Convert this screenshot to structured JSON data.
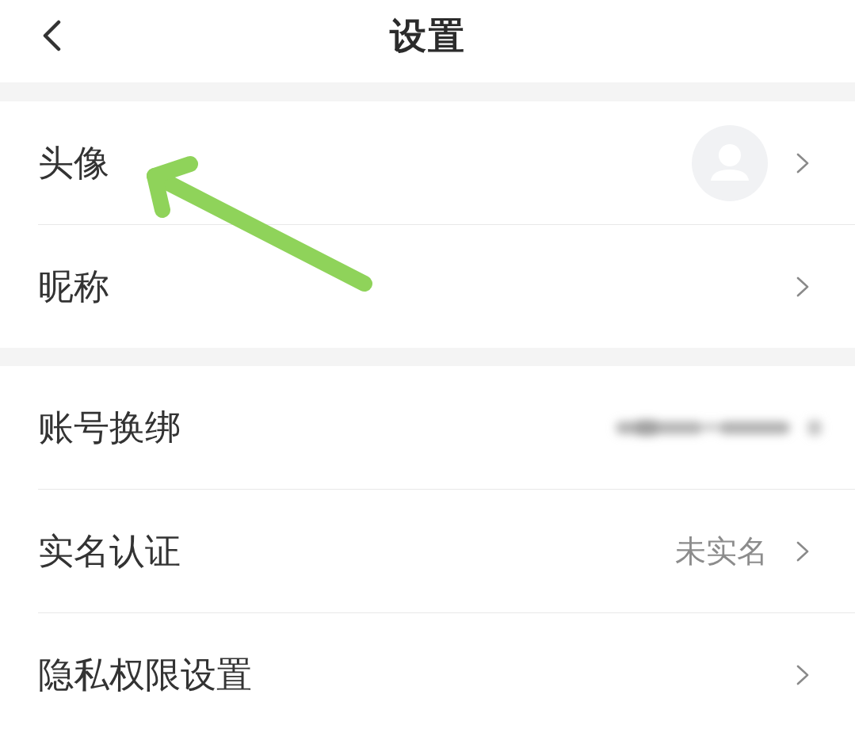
{
  "header": {
    "title": "设置"
  },
  "sections": [
    {
      "rows": [
        {
          "kind": "avatar",
          "label": "头像"
        },
        {
          "kind": "plain",
          "label": "昵称"
        }
      ]
    },
    {
      "rows": [
        {
          "kind": "redacted",
          "label": "账号换绑"
        },
        {
          "kind": "value",
          "label": "实名认证",
          "value": "未实名"
        },
        {
          "kind": "plain",
          "label": "隐私权限设置"
        }
      ]
    }
  ]
}
